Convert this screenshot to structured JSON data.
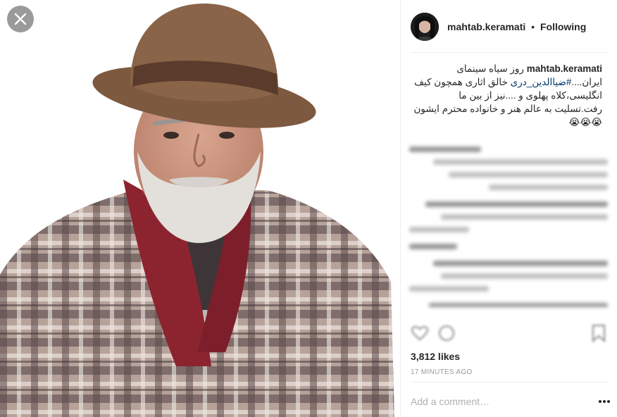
{
  "media": {
    "description_icon": "photo-portrait",
    "close_icon": "close-icon"
  },
  "post": {
    "username": "mahtab.keramati",
    "separator": "•",
    "follow_label": "Following",
    "caption": {
      "username": "mahtab.keramati",
      "text_before_tag": "روز سیاه سینمای ایران....",
      "hashtag": "#ضیاالدین_دری",
      "text_after_tag": " خالق اثاری همچون کیف انگلیسی،کلاه پهلوی و ....نیز از بین ما رفت.تسلیت به عالم هنر و خانواده محترم ایشون😭😭😭"
    },
    "likes": "3,812 likes",
    "time_ago": "17 MINUTES AGO",
    "add_comment_placeholder": "Add a comment…",
    "more_icon": "more-options-icon"
  },
  "colors": {
    "text": "#262626",
    "hashtag": "#003569",
    "muted": "#999999",
    "placeholder": "#b0b0b0"
  }
}
